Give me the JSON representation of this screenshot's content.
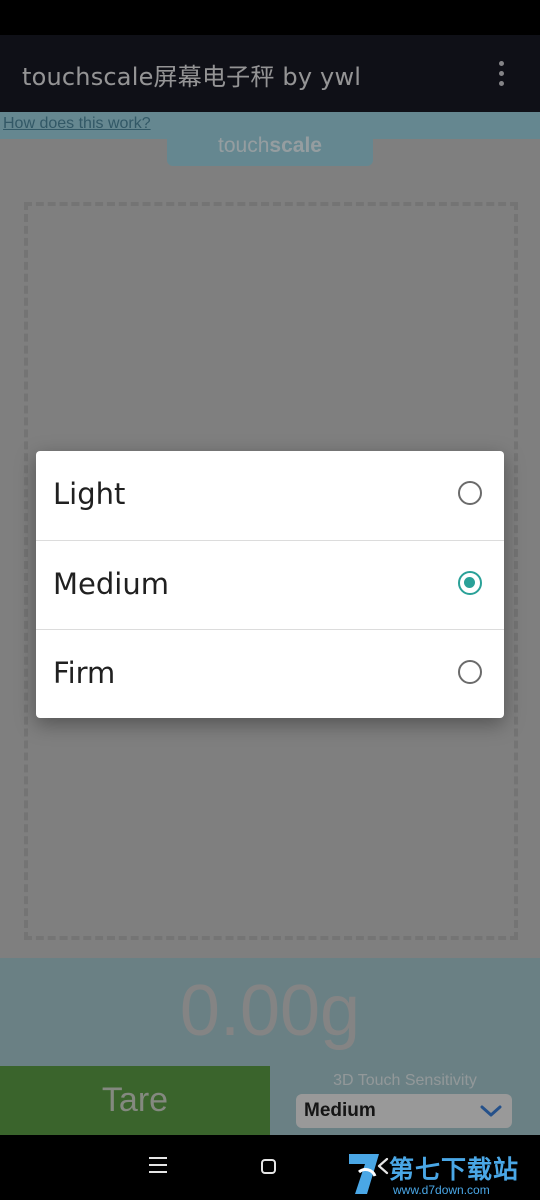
{
  "app_bar": {
    "title": "touchscale屏幕电子秤 by ywl",
    "menu_icon": "more-vert-icon"
  },
  "help": {
    "link": "How does this work?"
  },
  "brand": {
    "light": "touch",
    "bold": "scale"
  },
  "scale": {
    "weight": "0.00g"
  },
  "tare": {
    "label": "Tare"
  },
  "sensitivity": {
    "label": "3D Touch Sensitivity",
    "selected": "Medium"
  },
  "dialog": {
    "options": [
      {
        "label": "Light",
        "checked": false
      },
      {
        "label": "Medium",
        "checked": true
      },
      {
        "label": "Firm",
        "checked": false
      }
    ]
  },
  "watermark": {
    "cn": "第七下载站",
    "url": "www.d7down.com"
  },
  "colors": {
    "app_bar": "#181925",
    "accent_teal": "#2aa198",
    "help_strip": "#9ed4e2",
    "tare_green": "#5b9d46"
  }
}
